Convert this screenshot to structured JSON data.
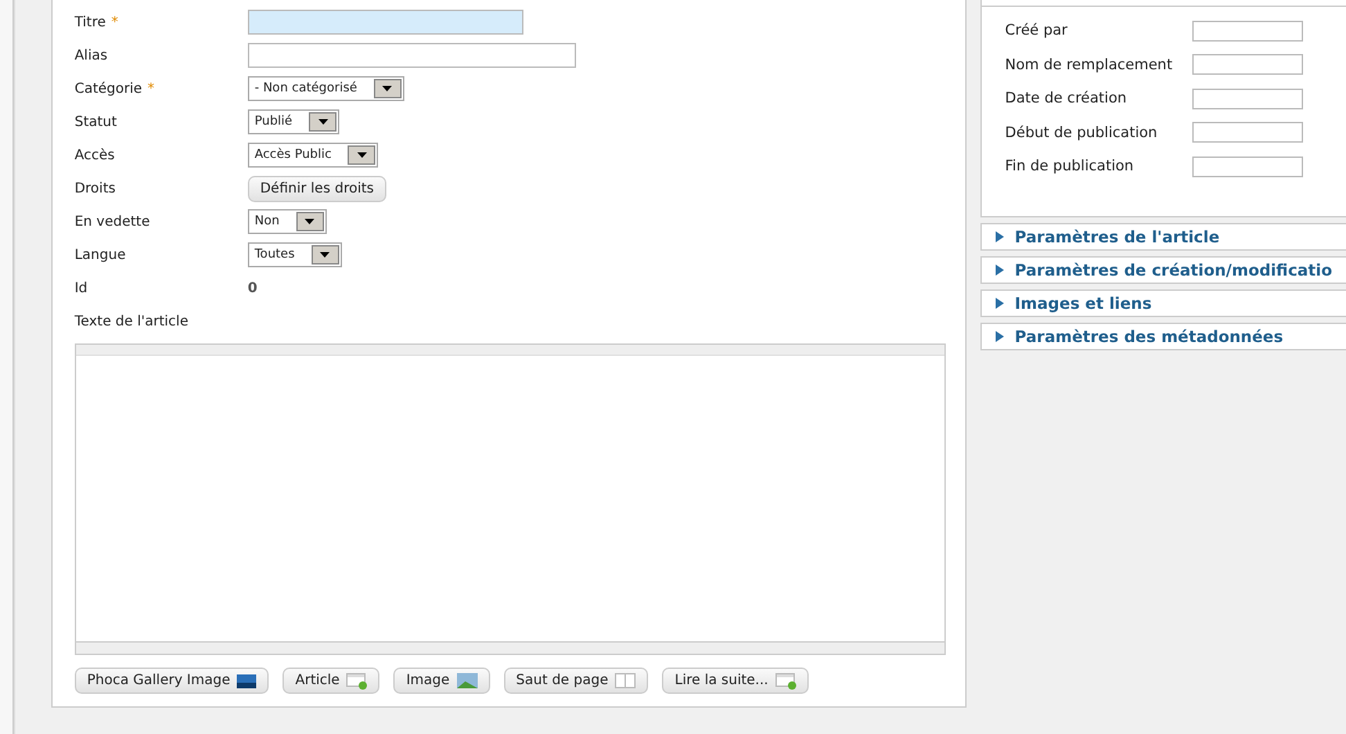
{
  "form": {
    "fields": [
      {
        "label": "Titre",
        "marker": "*",
        "kind": "text",
        "focused": true
      },
      {
        "label": "Alias",
        "kind": "wide_text",
        "focused": false
      },
      {
        "label": "Catégorie",
        "marker": "*",
        "kind": "select",
        "value": "- Non catégorisé"
      },
      {
        "label": "Statut",
        "kind": "select",
        "value": "Publié"
      },
      {
        "label": "Accès",
        "kind": "select",
        "value": "Accès Public"
      },
      {
        "label": "Droits",
        "kind": "button",
        "value": "Définir les droits"
      },
      {
        "label": "En vedette",
        "kind": "select",
        "value": "Non"
      },
      {
        "label": "Langue",
        "kind": "select",
        "value": "Toutes"
      },
      {
        "label": "Id",
        "kind": "static",
        "value": "0"
      }
    ],
    "editor_label": "Texte de l'article",
    "editor_buttons": [
      "Phoca Gallery Image",
      "Article",
      "Image",
      "Saut de page",
      "Lire la suite..."
    ]
  },
  "sidebar": {
    "publishing_fields": [
      "Créé par",
      "Nom de remplacement",
      "Date de création",
      "Début de publication",
      "Fin de publication"
    ],
    "panels": [
      {
        "title": "Paramètres de l'article",
        "expanded": false
      },
      {
        "title": "Paramètres de création/modificatio",
        "expanded": false
      },
      {
        "title": "Images et liens",
        "expanded": false
      },
      {
        "title": "Paramètres des métadonnées",
        "expanded": false
      }
    ]
  }
}
